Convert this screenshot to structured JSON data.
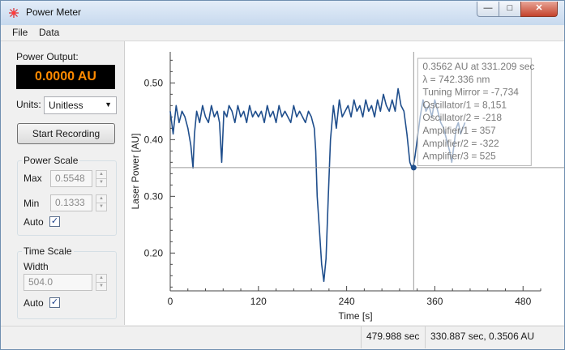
{
  "window": {
    "title": "Power Meter"
  },
  "menu": {
    "items": [
      "File",
      "Data"
    ]
  },
  "power_output": {
    "label": "Power Output:",
    "value": "0.0000 AU"
  },
  "units": {
    "label": "Units:",
    "selected": "Unitless"
  },
  "record_button": {
    "label": "Start Recording"
  },
  "power_scale": {
    "title": "Power Scale",
    "max_label": "Max",
    "max_value": "0.5548",
    "min_label": "Min",
    "min_value": "0.1333",
    "auto_label": "Auto",
    "auto_checked": true
  },
  "time_scale": {
    "title": "Time Scale",
    "width_label": "Width",
    "width_value": "504.0",
    "auto_label": "Auto",
    "auto_checked": true
  },
  "status": {
    "left": "479.988 sec",
    "right": "330.887 sec, 0.3506 AU"
  },
  "tooltip": {
    "lines": [
      "0.3562 AU at 331.209 sec",
      "λ = 742.336 nm",
      "Tuning Mirror = -7,734",
      "Oscillator/1 = 8,151",
      "Oscillator/2 = -218",
      "Amplifier/1 = 357",
      "Amplifier/2 = -322",
      "Amplifier/3 = 525"
    ]
  },
  "chart_data": {
    "type": "line",
    "title": "",
    "xlabel": "Time [s]",
    "ylabel": "Laser Power [AU]",
    "xlim": [
      0,
      504
    ],
    "ylim": [
      0.1333,
      0.5548
    ],
    "xticks": [
      0,
      120,
      240,
      360,
      480
    ],
    "xtick_labels": [
      "0",
      "120",
      "240",
      "360",
      "480"
    ],
    "yticks": [
      0.2,
      0.3,
      0.4,
      0.5
    ],
    "ytick_labels": [
      "0.20",
      "0.30",
      "0.40",
      "0.50"
    ],
    "grid": false,
    "line_color": "#1f4e8c",
    "crosshair": {
      "x": 331.209,
      "y": 0.3506
    },
    "series": [
      {
        "x": [
          0,
          4,
          8,
          12,
          16,
          20,
          24,
          28,
          31,
          33,
          36,
          40,
          44,
          48,
          52,
          56,
          60,
          64,
          67,
          70,
          73,
          77,
          80,
          84,
          88,
          92,
          96,
          100,
          104,
          108,
          112,
          116,
          120,
          124,
          128,
          132,
          136,
          140,
          144,
          148,
          152,
          156,
          160,
          164,
          168,
          172,
          176,
          180,
          184,
          188,
          192,
          196,
          198,
          200,
          203,
          206,
          209,
          212,
          215,
          218,
          222,
          226,
          230,
          234,
          238,
          242,
          246,
          250,
          254,
          258,
          262,
          266,
          270,
          274,
          278,
          282,
          286,
          290,
          294,
          298,
          302,
          306,
          310,
          314,
          318,
          322,
          326,
          329,
          331,
          333,
          336,
          340,
          344,
          348,
          352,
          356,
          360,
          364,
          368,
          372,
          376,
          380,
          383,
          386,
          389,
          392,
          395,
          398,
          401
        ],
        "y": [
          0.45,
          0.41,
          0.46,
          0.43,
          0.45,
          0.44,
          0.42,
          0.39,
          0.35,
          0.41,
          0.45,
          0.43,
          0.46,
          0.44,
          0.43,
          0.46,
          0.44,
          0.45,
          0.43,
          0.36,
          0.45,
          0.44,
          0.46,
          0.45,
          0.43,
          0.46,
          0.44,
          0.45,
          0.43,
          0.46,
          0.44,
          0.45,
          0.44,
          0.45,
          0.43,
          0.46,
          0.44,
          0.45,
          0.43,
          0.46,
          0.44,
          0.45,
          0.44,
          0.43,
          0.46,
          0.44,
          0.45,
          0.44,
          0.43,
          0.45,
          0.44,
          0.42,
          0.38,
          0.3,
          0.24,
          0.18,
          0.15,
          0.19,
          0.3,
          0.4,
          0.46,
          0.42,
          0.47,
          0.44,
          0.45,
          0.46,
          0.44,
          0.47,
          0.45,
          0.46,
          0.44,
          0.47,
          0.45,
          0.46,
          0.44,
          0.47,
          0.45,
          0.48,
          0.46,
          0.45,
          0.47,
          0.45,
          0.49,
          0.46,
          0.45,
          0.41,
          0.36,
          0.35,
          0.356,
          0.37,
          0.4,
          0.44,
          0.47,
          0.45,
          0.46,
          0.44,
          0.47,
          0.45,
          0.43,
          0.42,
          0.4,
          0.38,
          0.36,
          0.39,
          0.42,
          0.43,
          0.41,
          0.42,
          0.43
        ]
      }
    ]
  }
}
